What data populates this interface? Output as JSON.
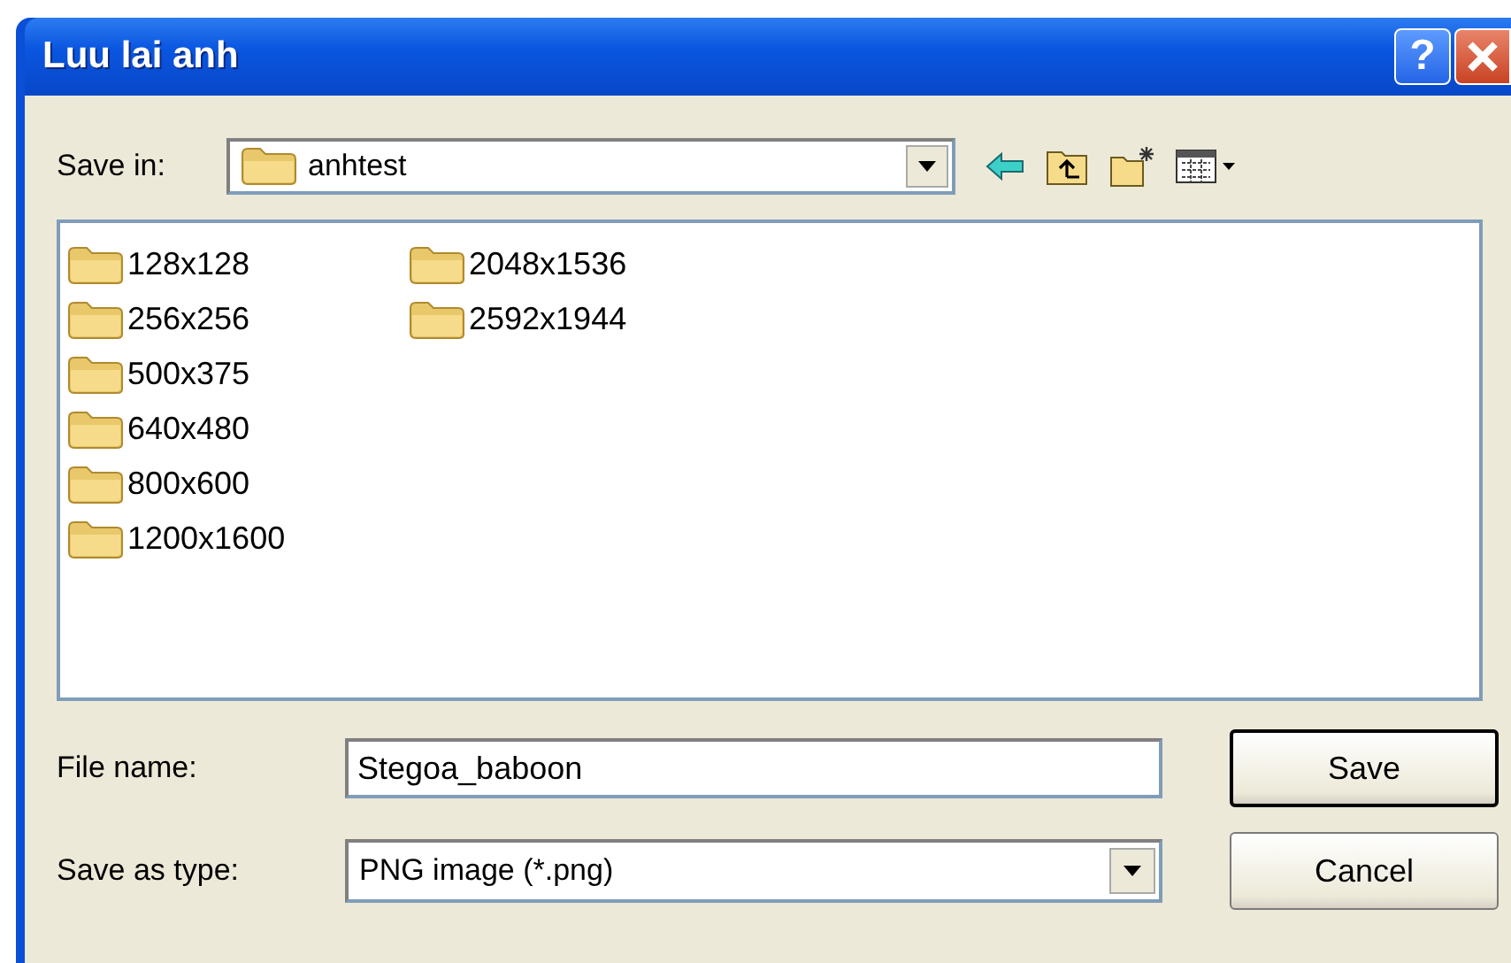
{
  "window": {
    "title": "Luu lai anh",
    "help_label": "?"
  },
  "save_in": {
    "label": "Save in:",
    "value": "anhtest"
  },
  "folders": [
    {
      "name": "128x128"
    },
    {
      "name": "256x256"
    },
    {
      "name": "500x375"
    },
    {
      "name": "640x480"
    },
    {
      "name": "800x600"
    },
    {
      "name": "1200x1600"
    },
    {
      "name": "2048x1536"
    },
    {
      "name": "2592x1944"
    }
  ],
  "file_name": {
    "label": "File name:",
    "value": "Stegoa_baboon"
  },
  "save_as_type": {
    "label": "Save as type:",
    "value": "PNG image (*.png)"
  },
  "buttons": [
    {
      "label": "Save",
      "default": true
    },
    {
      "label": "Cancel",
      "default": false
    }
  ]
}
